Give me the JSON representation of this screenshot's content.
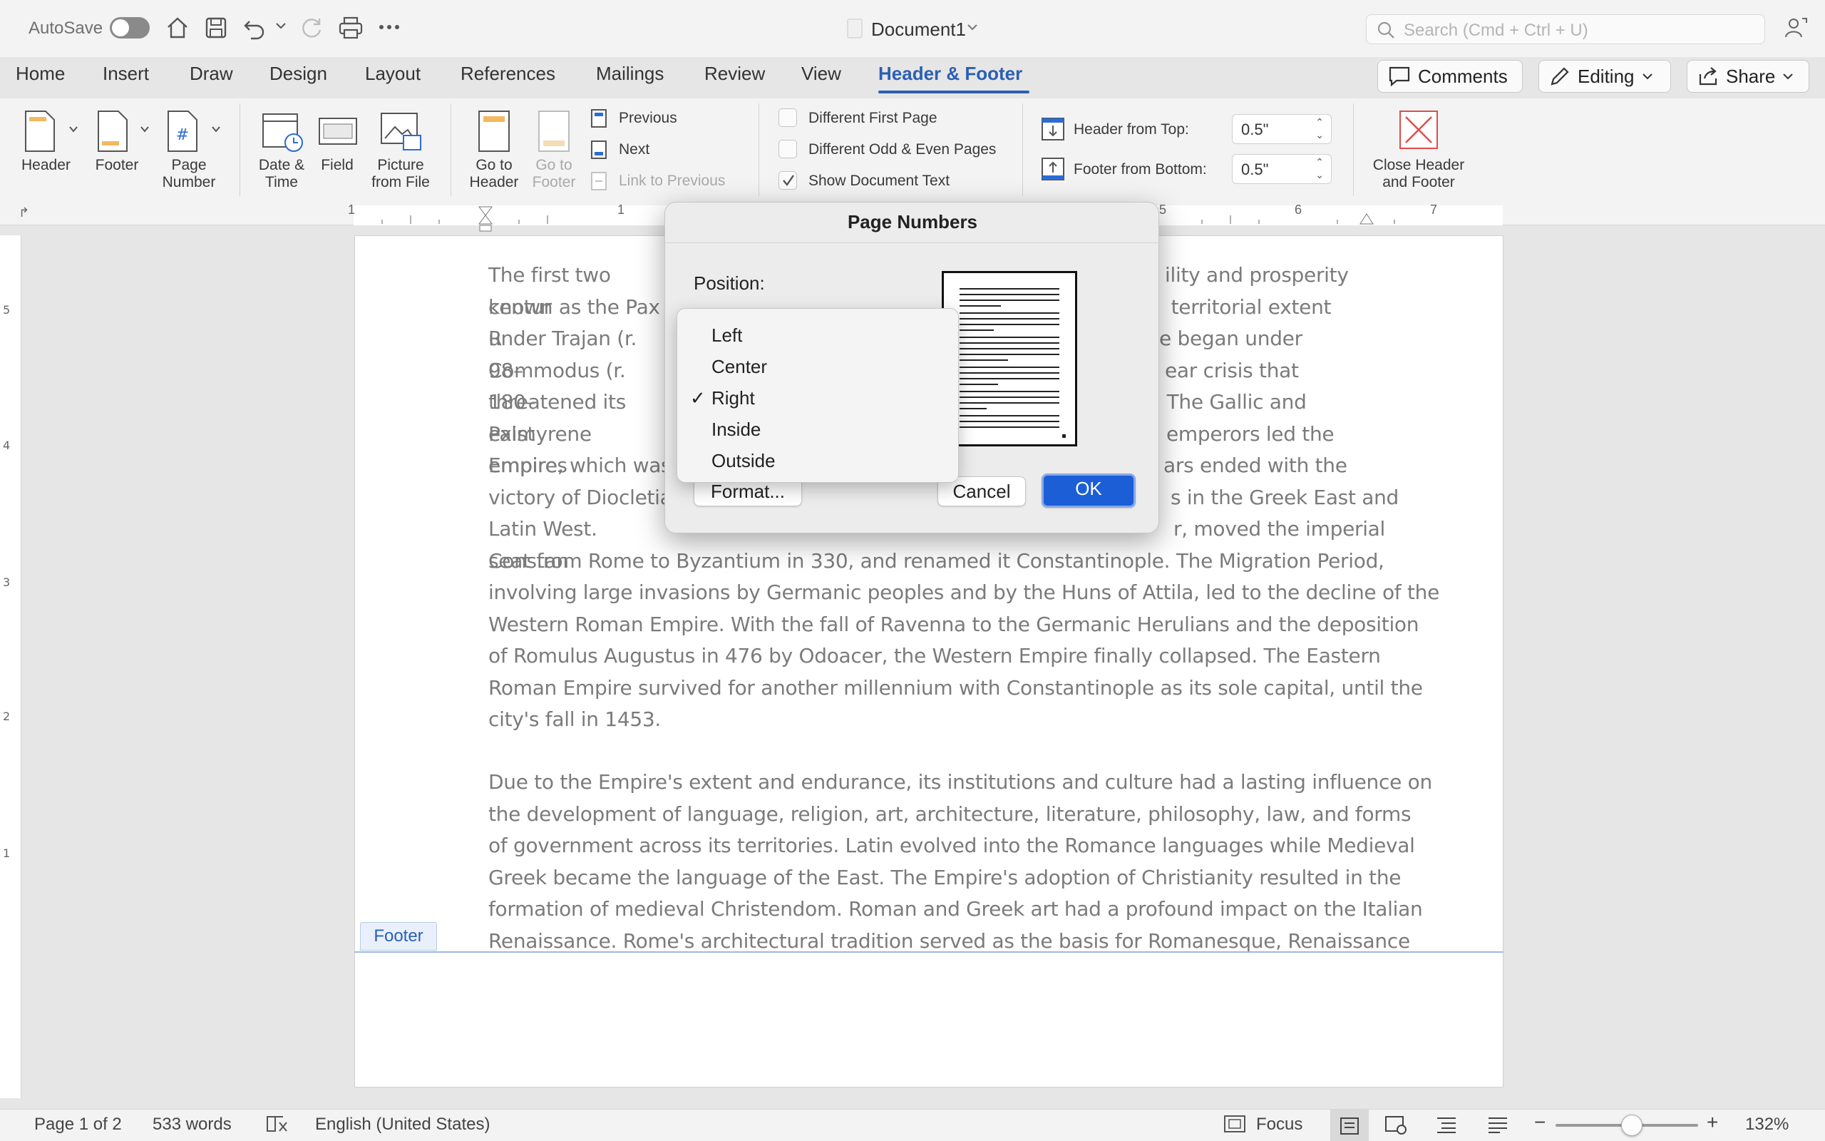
{
  "titlebar": {
    "autosave_label": "AutoSave",
    "document_title": "Document1",
    "search_placeholder": "Search (Cmd + Ctrl + U)"
  },
  "tabs": [
    {
      "label": "Home"
    },
    {
      "label": "Insert"
    },
    {
      "label": "Draw"
    },
    {
      "label": "Design"
    },
    {
      "label": "Layout"
    },
    {
      "label": "References"
    },
    {
      "label": "Mailings"
    },
    {
      "label": "Review"
    },
    {
      "label": "View"
    },
    {
      "label": "Header & Footer",
      "active": true
    }
  ],
  "actions": {
    "comments": "Comments",
    "editing": "Editing",
    "share": "Share"
  },
  "ribbon": {
    "header": "Header",
    "footer": "Footer",
    "page_number_l1": "Page",
    "page_number_l2": "Number",
    "date_time_l1": "Date &",
    "date_time_l2": "Time",
    "field": "Field",
    "picture_l1": "Picture",
    "picture_l2": "from File",
    "goto_header_l1": "Go to",
    "goto_header_l2": "Header",
    "goto_footer_l1": "Go to",
    "goto_footer_l2": "Footer",
    "previous": "Previous",
    "next": "Next",
    "link_to_previous": "Link to Previous",
    "different_first_page": "Different First Page",
    "different_odd_even": "Different Odd & Even Pages",
    "show_document_text": "Show Document Text",
    "header_from_top_label": "Header from Top:",
    "header_from_top_value": "0.5\"",
    "footer_from_bottom_label": "Footer from Bottom:",
    "footer_from_bottom_value": "0.5\"",
    "close_l1": "Close Header",
    "close_l2": "and Footer"
  },
  "ruler": {
    "numbers": [
      "1",
      "1",
      "5",
      "6",
      "7"
    ]
  },
  "document": {
    "paragraph1_lines": [
      "The first two centur",
      "known as the Pax R",
      "under Trajan (r. 98–",
      "Commodus (r. 180–",
      "threatened its exist",
      "Palmyrene empires",
      "Empire, which was",
      "victory of Diocletia",
      "Latin West. Constan"
    ],
    "paragraph1_right_lines": [
      "ility and prosperity",
      " territorial extent",
      "e began under",
      "ear crisis that",
      " The Gallic and",
      "emperors led the",
      "ars ended with the",
      "s in the Greek East and",
      "r, moved the imperial"
    ],
    "paragraph1_full_lines": [
      "seat from Rome to Byzantium in 330, and renamed it Constantinople. The Migration Period,",
      "involving large invasions by Germanic peoples and by the Huns of Attila, led to the decline of the",
      "Western Roman Empire. With the fall of Ravenna to the Germanic Herulians and the deposition",
      "of Romulus Augustus in 476 by Odoacer, the Western Empire finally collapsed. The Eastern",
      "Roman Empire survived for another millennium with Constantinople as its sole capital, until the",
      "city's fall in 1453."
    ],
    "paragraph2_lines": [
      "Due to the Empire's extent and endurance, its institutions and culture had a lasting influence on",
      "the development of language, religion, art, architecture, literature, philosophy, law, and forms",
      "of government across its territories. Latin evolved into the Romance languages while Medieval",
      "Greek became the language of the East. The Empire's adoption of Christianity resulted in the",
      "formation of medieval Christendom. Roman and Greek art had a profound impact on the Italian",
      "Renaissance. Rome's architectural tradition served as the basis for Romanesque, Renaissance"
    ],
    "footer_tag": "Footer"
  },
  "dialog": {
    "title": "Page Numbers",
    "position_label": "Position:",
    "menu_items": [
      "Left",
      "Center",
      "Right",
      "Inside",
      "Outside"
    ],
    "selected": "Right",
    "format_button": "Format...",
    "cancel_button": "Cancel",
    "ok_button": "OK"
  },
  "status": {
    "page": "Page 1 of 2",
    "words": "533 words",
    "language": "English (United States)",
    "focus": "Focus",
    "zoom": "132%"
  },
  "colors": {
    "accent": "#2b5fb3",
    "ok_button": "#1c5ed6",
    "close_icon": "#e04b4b"
  }
}
